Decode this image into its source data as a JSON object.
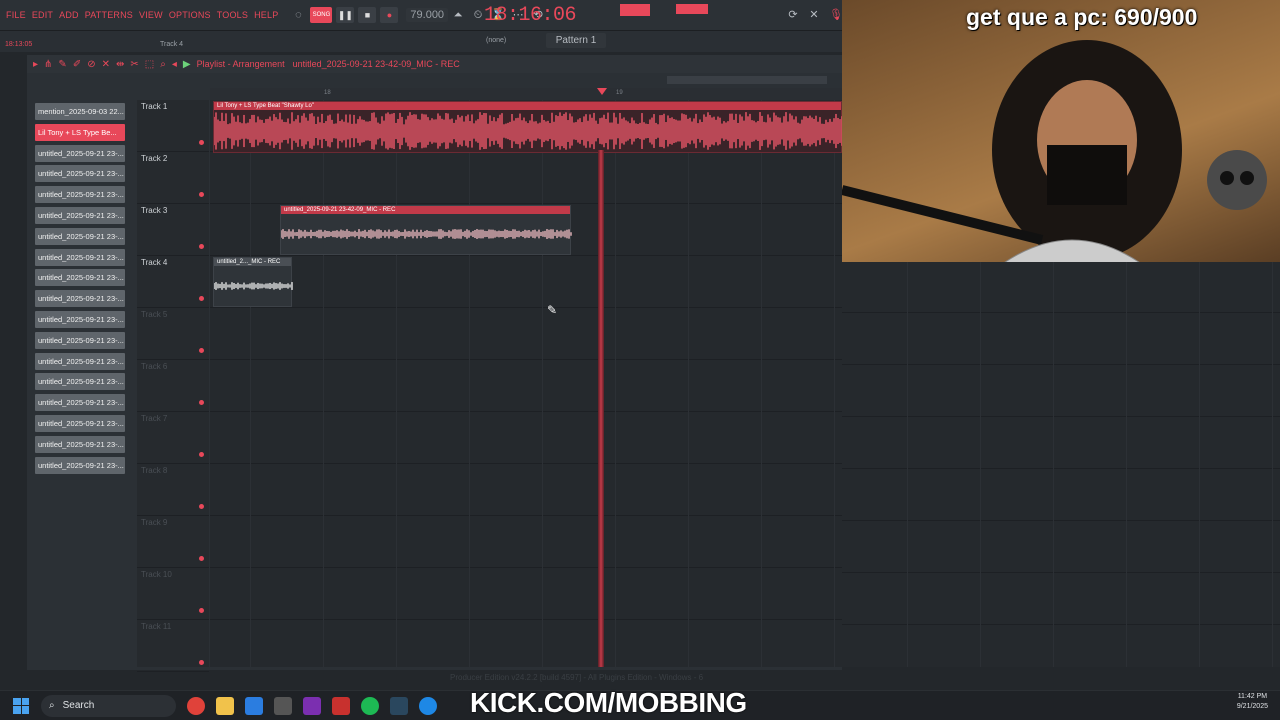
{
  "menu": [
    "FILE",
    "EDIT",
    "ADD",
    "PATTERNS",
    "VIEW",
    "OPTIONS",
    "TOOLS",
    "HELP"
  ],
  "transport": {
    "tempo": "79.000",
    "clock": "18:16:06",
    "song_label": "SONG"
  },
  "subtoolbar": {
    "time": "18:13:05",
    "track_hint": "Track 4",
    "pattern": "Pattern 1",
    "pattern_none": "(none)"
  },
  "playlist": {
    "title": "Playlist - Arrangement",
    "breadcrumb": "untitled_2025-09-21 23-42-09_MIC - REC",
    "ruler": [
      "18",
      "19"
    ]
  },
  "picker": [
    "mention_2025-09-03 22...",
    "Lil Tony + LS Type Be...",
    "untitled_2025-09-21 23-...",
    "untitled_2025-09-21 23-...",
    "untitled_2025-09-21 23-...",
    "untitled_2025-09-21 23-...",
    "untitled_2025-09-21 23-...",
    "untitled_2025-09-21 23-...",
    "untitled_2025-09-21 23-...",
    "untitled_2025-09-21 23-...",
    "untitled_2025-09-21 23-...",
    "untitled_2025-09-21 23-...",
    "untitled_2025-09-21 23-...",
    "untitled_2025-09-21 23-...",
    "untitled_2025-09-21 23-...",
    "untitled_2025-09-21 23-...",
    "untitled_2025-09-21 23-...",
    "untitled_2025-09-21 23-..."
  ],
  "tracks": [
    "Track 1",
    "Track 2",
    "Track 3",
    "Track 4",
    "Track 5",
    "Track 6",
    "Track 7",
    "Track 8",
    "Track 9",
    "Track 10",
    "Track 11"
  ],
  "clips": [
    {
      "title": "Lil Tony + LS Type Beat \"Shawty Lo\""
    },
    {
      "title": "untitled_2025-09-21 23-42-09_MIC - REC"
    },
    {
      "title": "untitled_2..._MIC - REC"
    }
  ],
  "overlay": {
    "cam_title": "get que a pc: 690/900",
    "kick": "KICK.COM/MOBBING"
  },
  "status": "Producer Edition v24.2.2 [build 4597] - All Plugins Edition - Windows - 6",
  "taskbar": {
    "search": "Search",
    "time": "11:42 PM",
    "date": "9/21/2025"
  },
  "colors": {
    "accent": "#e8485a",
    "bg": "#23272b"
  }
}
